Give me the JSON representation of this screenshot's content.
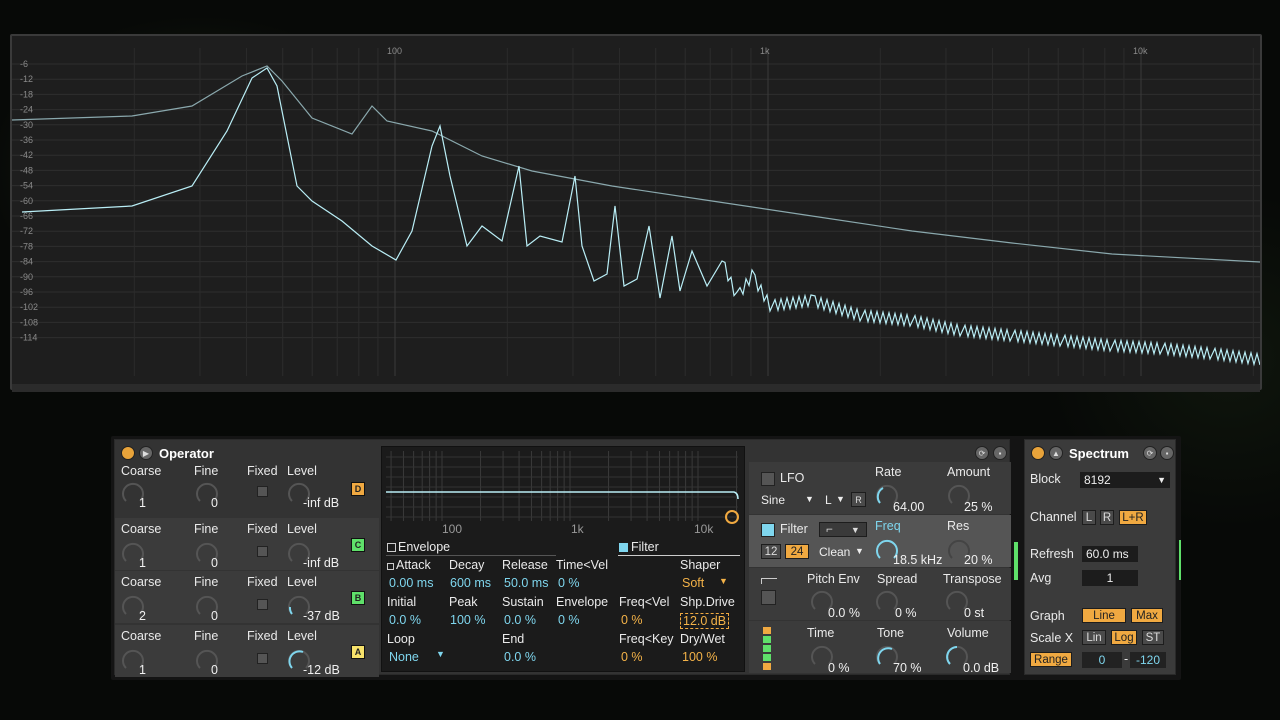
{
  "spectrum_display": {
    "y_ticks": [
      "-6",
      "-12",
      "-18",
      "-24",
      "-30",
      "-36",
      "-42",
      "-48",
      "-54",
      "-60",
      "-66",
      "-72",
      "-78",
      "-84",
      "-90",
      "-96",
      "-102",
      "-108",
      "-114"
    ],
    "x_ticks": [
      "100",
      "1k",
      "10k"
    ]
  },
  "operator": {
    "title": "Operator",
    "labels": {
      "coarse": "Coarse",
      "fine": "Fine",
      "fixed": "Fixed",
      "level": "Level"
    },
    "rows": [
      {
        "tag": "D",
        "coarse": "1",
        "fine": "0",
        "level": "-inf dB",
        "tag_color": "#f0a941"
      },
      {
        "tag": "C",
        "coarse": "1",
        "fine": "0",
        "level": "-inf dB",
        "tag_color": "#5fe06a"
      },
      {
        "tag": "B",
        "coarse": "2",
        "fine": "0",
        "level": "-37 dB",
        "tag_color": "#5fe06a"
      },
      {
        "tag": "A",
        "coarse": "1",
        "fine": "0",
        "level": "-12 dB",
        "tag_color": "#f7e26b"
      }
    ],
    "graph_ticks": [
      "100",
      "1k",
      "10k"
    ],
    "envelope_tab": "Envelope",
    "filter_tab": "Filter",
    "env": {
      "attack_label": "Attack",
      "attack": "0.00 ms",
      "decay_label": "Decay",
      "decay": "600 ms",
      "release_label": "Release",
      "release": "50.0 ms",
      "timevel_label": "Time<Vel",
      "timevel": "0 %",
      "initial_label": "Initial",
      "initial": "0.0 %",
      "peak_label": "Peak",
      "peak": "100 %",
      "sustain_label": "Sustain",
      "sustain": "0.0 %",
      "envelope_label": "Envelope",
      "envelope": "0 %",
      "loop_label": "Loop",
      "loop": "None",
      "end_label": "End",
      "end": "0.0 %"
    },
    "filt": {
      "shaper_label": "Shaper",
      "shaper": "Soft",
      "freqvel_label": "Freq<Vel",
      "freqvel": "0 %",
      "shpdrive_label": "Shp.Drive",
      "shpdrive": "12.0 dB",
      "freqkey_label": "Freq<Key",
      "freqkey": "0 %",
      "drywet_label": "Dry/Wet",
      "drywet": "100 %"
    },
    "lfo": {
      "title": "LFO",
      "wave": "Sine",
      "mode": "L",
      "retrig": "R",
      "rate_label": "Rate",
      "rate": "64.00",
      "amount_label": "Amount",
      "amount": "25 %"
    },
    "filter": {
      "title": "Filter",
      "slope12": "12",
      "slope24": "24",
      "circuit": "Clean",
      "freq_label": "Freq",
      "freq": "18.5 kHz",
      "res_label": "Res",
      "res": "20 %"
    },
    "pitch": {
      "title": "Pitch Env",
      "value": "0.0 %",
      "spread_label": "Spread",
      "spread": "0 %",
      "transpose_label": "Transpose",
      "transpose": "0 st"
    },
    "global": {
      "time_label": "Time",
      "time": "0 %",
      "tone_label": "Tone",
      "tone": "70 %",
      "volume_label": "Volume",
      "volume": "0.0 dB"
    }
  },
  "spectrum_device": {
    "title": "Spectrum",
    "block_label": "Block",
    "block": "8192",
    "channel_label": "Channel",
    "ch_l": "L",
    "ch_r": "R",
    "ch_lr": "L+R",
    "refresh_label": "Refresh",
    "refresh": "60.0 ms",
    "avg_label": "Avg",
    "avg": "1",
    "graph_label": "Graph",
    "graph_line": "Line",
    "graph_max": "Max",
    "scalex_label": "Scale X",
    "scale_lin": "Lin",
    "scale_log": "Log",
    "scale_st": "ST",
    "range_label": "Range",
    "range_lo": "0",
    "range_hi": "-120"
  }
}
